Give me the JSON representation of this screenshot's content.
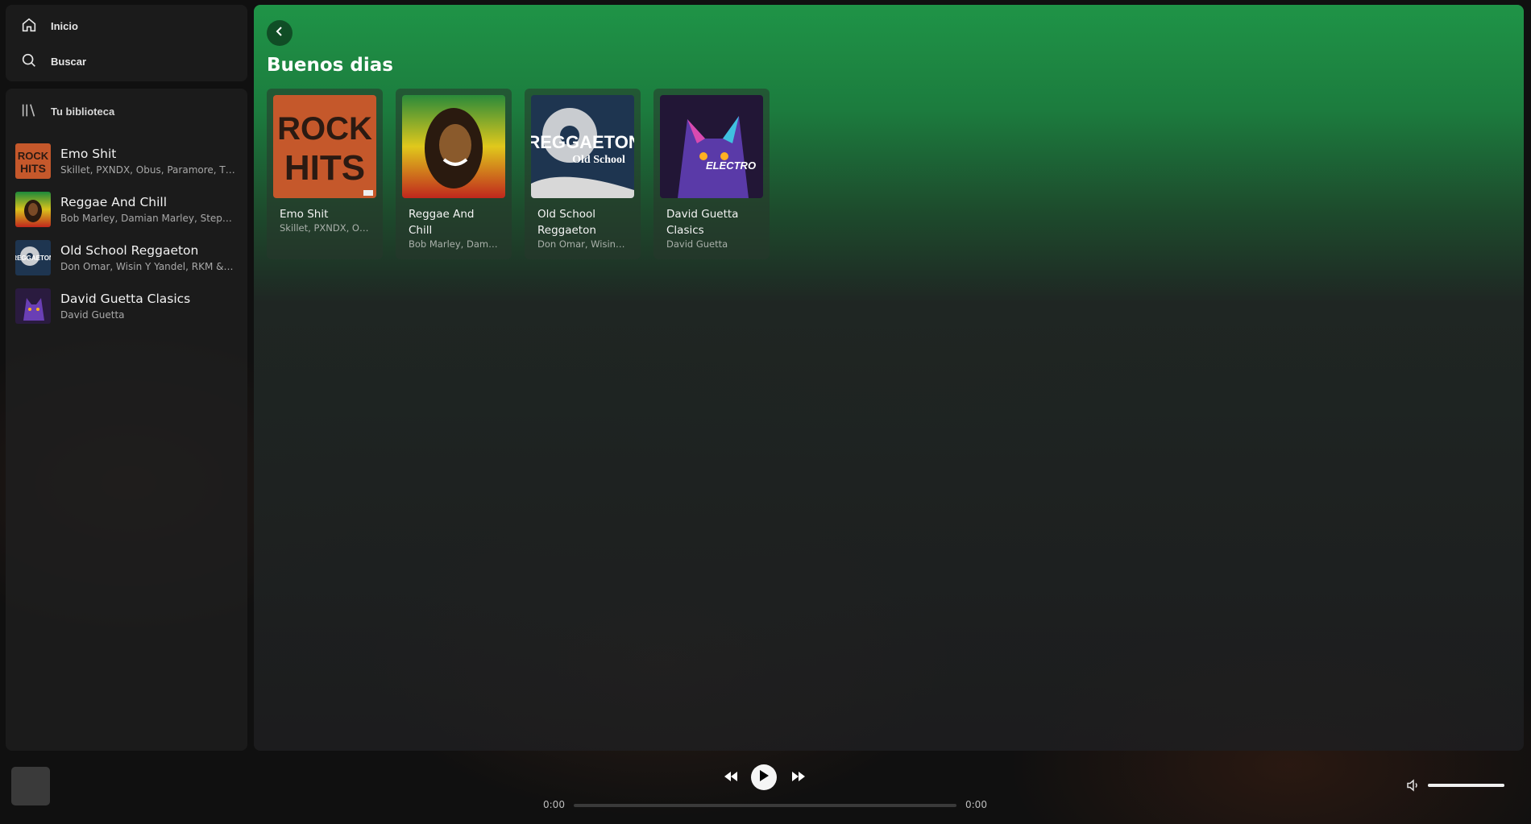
{
  "nav": {
    "home_label": "Inicio",
    "search_label": "Buscar"
  },
  "library": {
    "header_label": "Tu biblioteca",
    "items": [
      {
        "title": "Emo Shit",
        "subtitle": "Skillet, PXNDX, Obus, Paramore, Thirty Seconds to Mars"
      },
      {
        "title": "Reggae And Chill",
        "subtitle": "Bob Marley, Damian Marley, Stephen Marley"
      },
      {
        "title": "Old School Reggaeton",
        "subtitle": "Don Omar, Wisin Y Yandel, RKM & Ken-Y"
      },
      {
        "title": "David Guetta Clasics",
        "subtitle": "David Guetta"
      }
    ]
  },
  "main": {
    "greeting": "Buenos dias",
    "cards": [
      {
        "title": "Emo Shit",
        "subtitle": "Skillet, PXNDX, Obus"
      },
      {
        "title": "Reggae And Chill",
        "subtitle": "Bob Marley, Damian Marley"
      },
      {
        "title": "Old School Reggaeton",
        "subtitle": "Don Omar, Wisin Y Yandel"
      },
      {
        "title": "David Guetta Clasics",
        "subtitle": "David Guetta"
      }
    ]
  },
  "player": {
    "time_current": "0:00",
    "time_total": "0:00",
    "progress": 0,
    "volume": 1.0
  },
  "art_text": {
    "rock_line1": "ROCK",
    "rock_line2": "HITS",
    "reggaeton_line1": "REGGAETON",
    "reggaeton_line2": "Old School",
    "electro": "ELECTRO"
  },
  "icons": {
    "home": "home-icon",
    "search": "search-icon",
    "library": "library-icon",
    "back": "chevron-left-icon",
    "prev": "rewind-icon",
    "play": "play-icon",
    "next": "fast-forward-icon",
    "volume": "volume-icon"
  },
  "colors": {
    "accent_green": "#1f9447",
    "panel": "#1e1e1e"
  }
}
